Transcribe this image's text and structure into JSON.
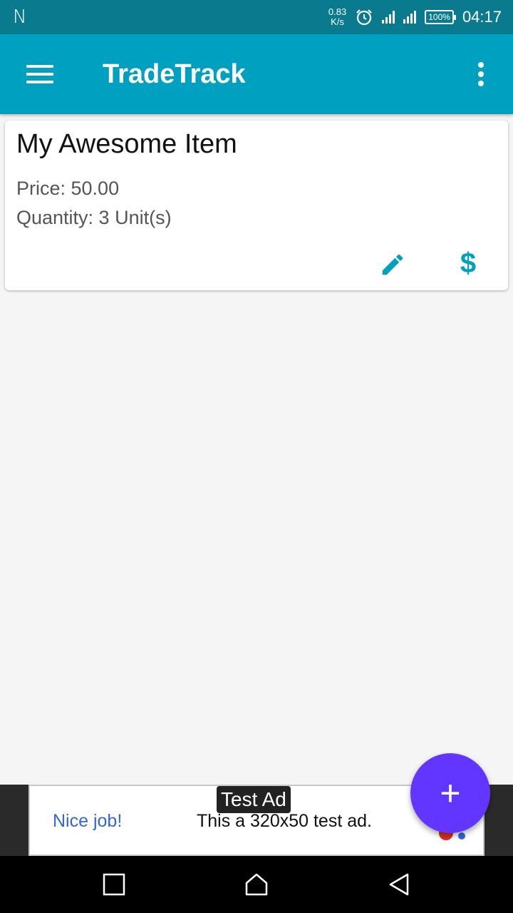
{
  "status_bar": {
    "carrier_icon": "N",
    "net_speed_value": "0.83",
    "net_speed_unit": "K/s",
    "battery": "100%",
    "time": "04:17",
    "icons": [
      "alarm-icon",
      "signal-icon",
      "signal-4g-icon",
      "battery-icon"
    ]
  },
  "app_bar": {
    "title": "TradeTrack",
    "menu_icon": "menu-icon",
    "overflow_icon": "more-vert-icon"
  },
  "items": [
    {
      "name": "My Awesome Item",
      "price": "Price: 50.00",
      "quantity": "Quantity: 3 Unit(s)",
      "edit_icon": "pencil-icon",
      "sell_icon": "$"
    }
  ],
  "ad": {
    "label": "Test Ad",
    "headline": "Nice job!",
    "body": "This a 320x50 test ad."
  },
  "fab": {
    "label": "+"
  },
  "colors": {
    "status_bar": "#0a7a8e",
    "app_bar": "#00a0c0",
    "accent": "#00a0c0",
    "fab": "#6236ff",
    "background": "#f5f5f5"
  }
}
